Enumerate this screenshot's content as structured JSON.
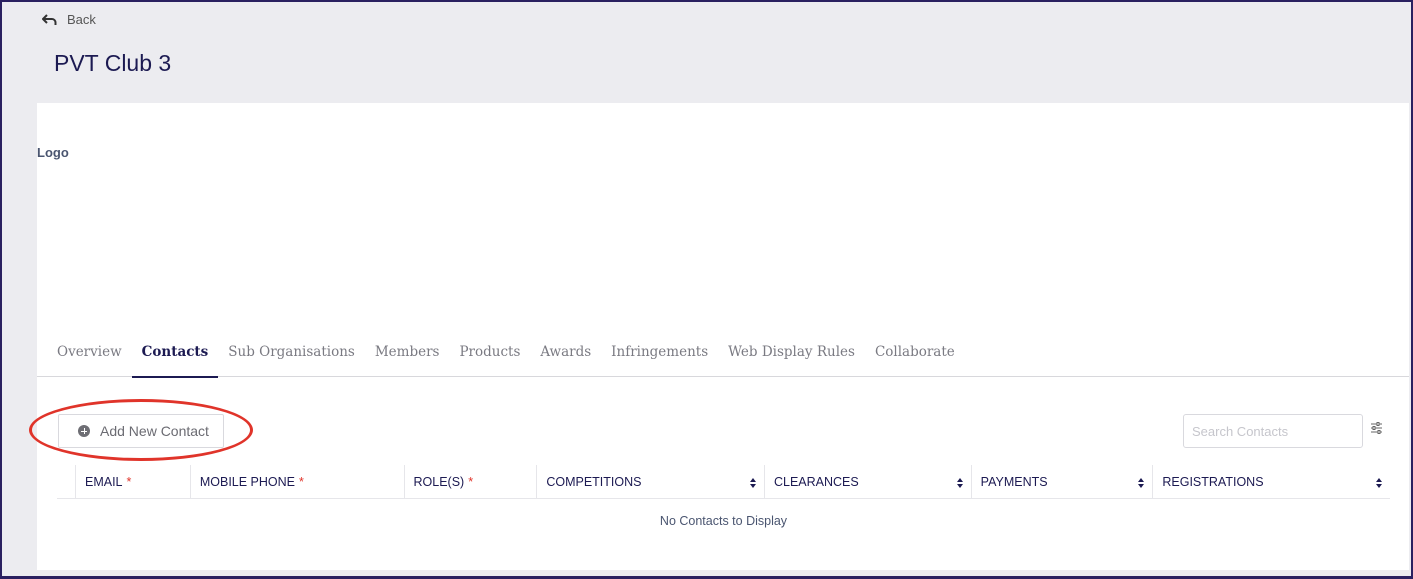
{
  "header": {
    "back_label": "Back",
    "title": "PVT Club 3"
  },
  "logo": {
    "label": "Logo"
  },
  "tabs": [
    {
      "label": "Overview",
      "active": false
    },
    {
      "label": "Contacts",
      "active": true
    },
    {
      "label": "Sub Organisations",
      "active": false
    },
    {
      "label": "Members",
      "active": false
    },
    {
      "label": "Products",
      "active": false
    },
    {
      "label": "Awards",
      "active": false
    },
    {
      "label": "Infringements",
      "active": false
    },
    {
      "label": "Web Display Rules",
      "active": false
    },
    {
      "label": "Collaborate",
      "active": false
    }
  ],
  "toolbar": {
    "add_label": "Add New Contact",
    "search_placeholder": "Search Contacts"
  },
  "table": {
    "columns": [
      {
        "label": "EMAIL",
        "required": "*",
        "sortable": false
      },
      {
        "label": "MOBILE PHONE",
        "required": "*",
        "sortable": false
      },
      {
        "label": "ROLE(S)",
        "required": "*",
        "sortable": false
      },
      {
        "label": "COMPETITIONS",
        "required": "",
        "sortable": true
      },
      {
        "label": "CLEARANCES",
        "required": "",
        "sortable": true
      },
      {
        "label": "PAYMENTS",
        "required": "",
        "sortable": true
      },
      {
        "label": "REGISTRATIONS",
        "required": "",
        "sortable": true
      }
    ],
    "empty_text": "No Contacts to Display"
  },
  "colors": {
    "primary": "#1c1a52",
    "highlight": "#e0342a",
    "background": "#ececf0"
  }
}
